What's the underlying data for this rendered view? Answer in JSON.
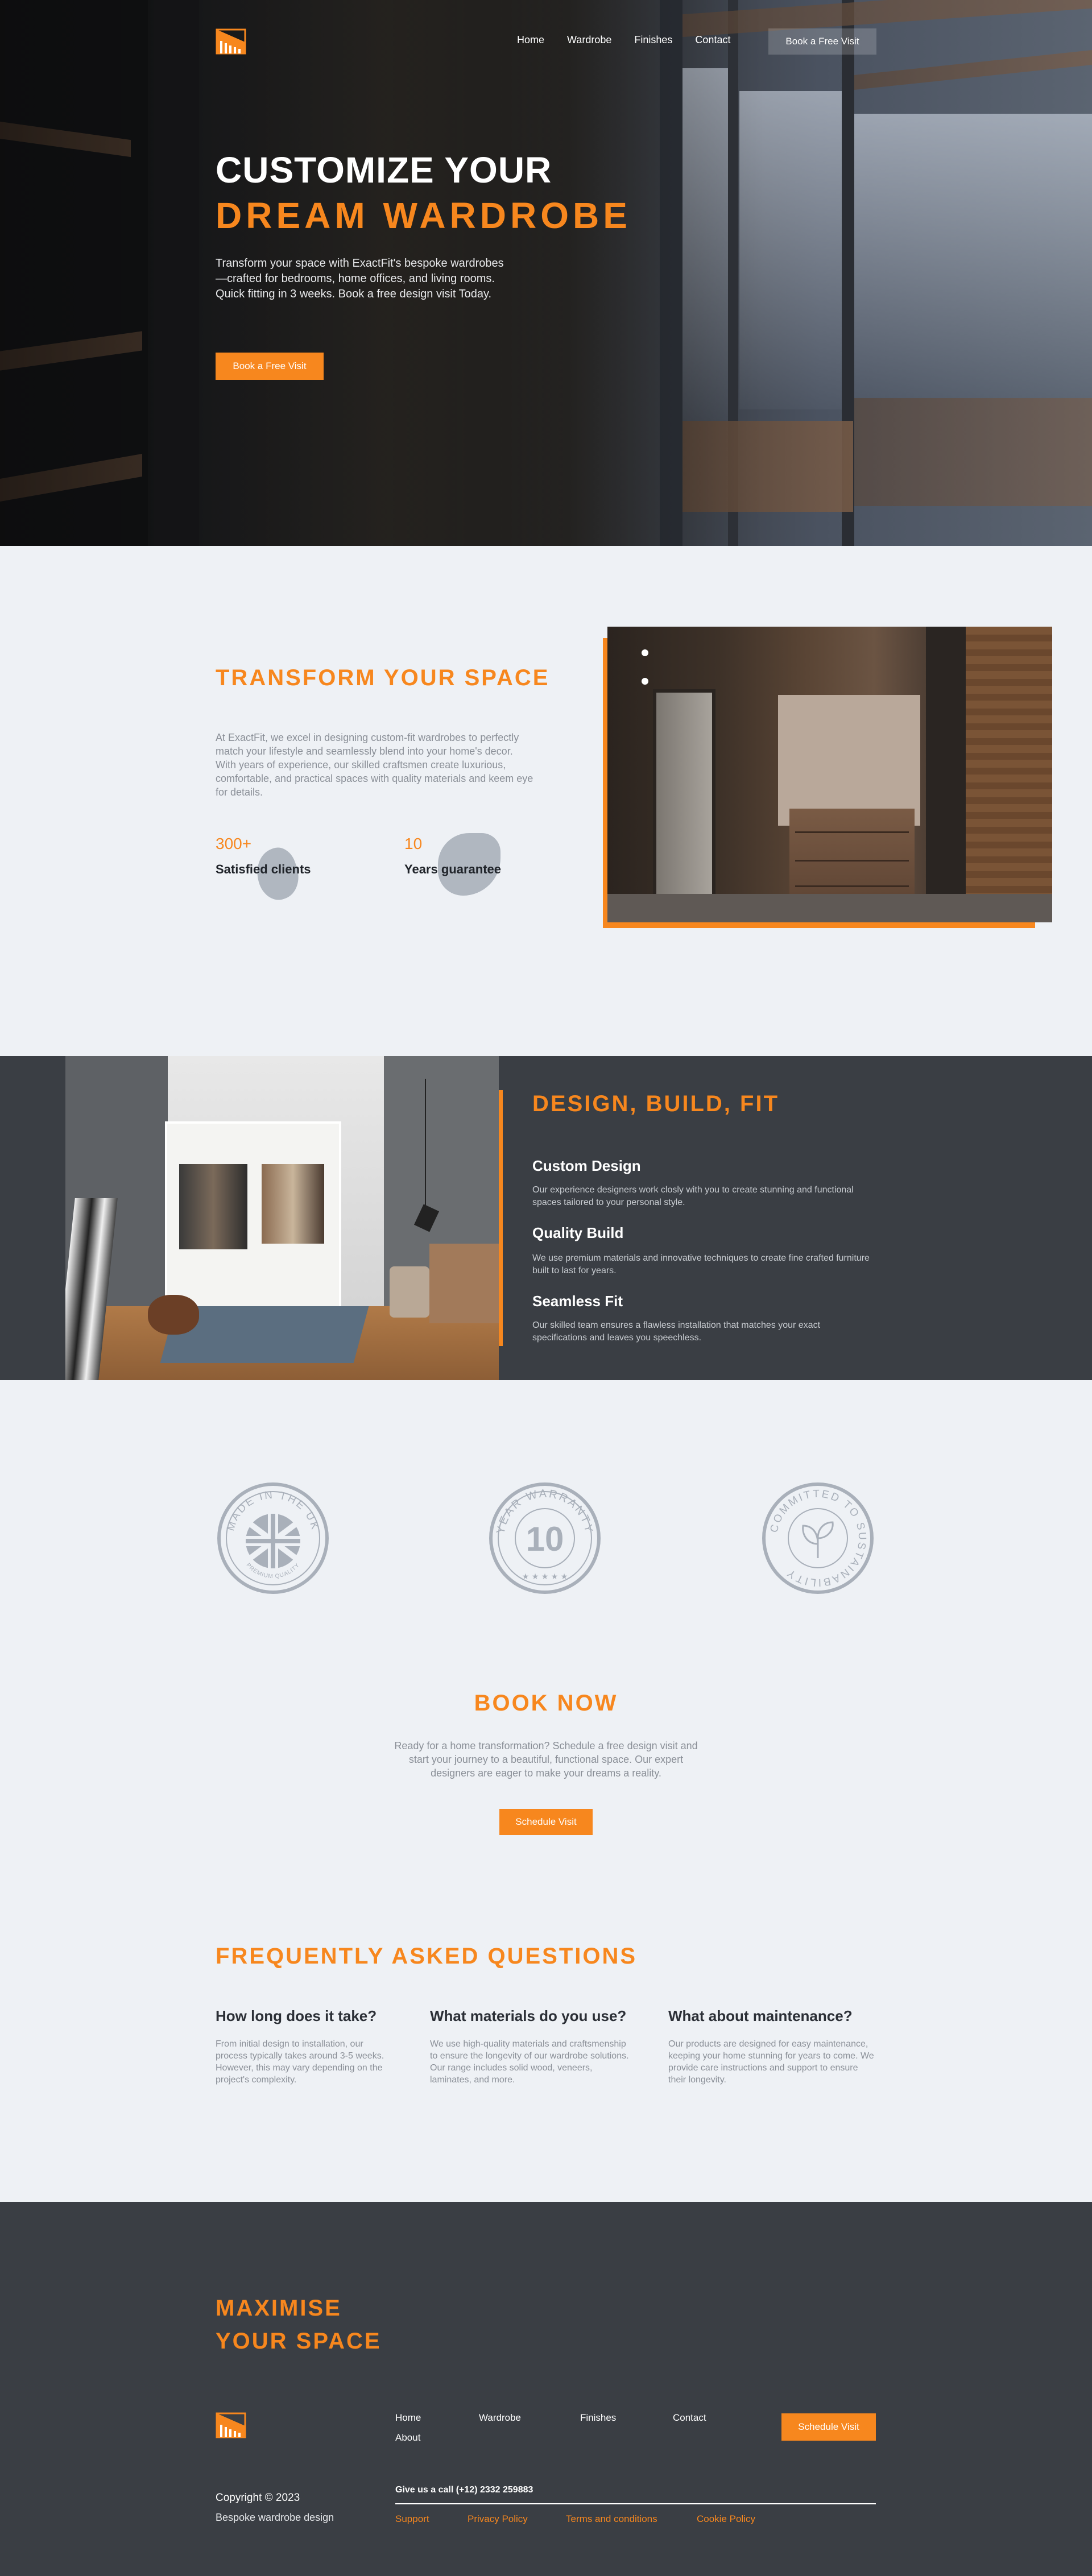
{
  "nav": {
    "links": [
      "Home",
      "Wardrobe",
      "Finishes",
      "Contact"
    ],
    "cta": "Book a Free Visit"
  },
  "hero": {
    "title_line1": "CUSTOMIZE YOUR",
    "title_line2": "DREAM WARDROBE",
    "text": "Transform your space with ExactFit's bespoke wardrobes—crafted for bedrooms, home offices, and living rooms. Quick fitting in 3 weeks. Book a free design visit Today.",
    "button": "Book a Free Visit"
  },
  "transform": {
    "title": "TRANSFORM YOUR SPACE",
    "text": "At ExactFit, we excel in designing custom-fit wardrobes to perfectly match your lifestyle and seamlessly blend into your home's decor. With years of experience, our skilled craftsmen create luxurious, comfortable, and practical spaces with quality materials and keem eye for details.",
    "stats": [
      {
        "value": "300+",
        "label": "Satisfied clients"
      },
      {
        "value": "10",
        "label": "Years guarantee"
      }
    ]
  },
  "dbf": {
    "title": "DESIGN, BUILD, FIT",
    "items": [
      {
        "heading": "Custom Design",
        "text": "Our experience designers work closly with you to create stunning and functional spaces tailored to your personal style."
      },
      {
        "heading": "Quality Build",
        "text": "We use premium materials and innovative techniques to create fine crafted furniture built to last for years."
      },
      {
        "heading": "Seamless Fit",
        "text": "Our skilled team ensures a flawless installation that matches your exact specifications and leaves you speechless."
      }
    ]
  },
  "badges": {
    "uk": {
      "top": "MADE IN THE UK",
      "bottom": "PREMIUM QUALITY"
    },
    "warranty": {
      "top": "YEAR WARRANTY",
      "number": "10"
    },
    "sustain": {
      "text": "COMMITTED TO SUSTAINABILITY"
    }
  },
  "book": {
    "title": "BOOK NOW",
    "text": "Ready for a home transformation? Schedule a free design visit and start your journey to a beautiful, functional space. Our expert designers are eager to make your dreams a reality.",
    "button": "Schedule Visit"
  },
  "faq": {
    "title": "FREQUENTLY ASKED QUESTIONS",
    "items": [
      {
        "q": "How long does it take?",
        "a": "From initial design to installation, our process typically takes around 3-5 weeks. However, this may vary depending on the project's complexity."
      },
      {
        "q": "What materials do you use?",
        "a": "We use high-quality materials and craftsmenship to ensure the longevity of our wardrobe solutions. Our range includes solid wood, veneers, laminates, and more."
      },
      {
        "q": "What about maintenance?",
        "a": "Our products are designed for easy maintenance, keeping your home stunning for years to come. We provide care instructions and support to ensure their longevity."
      }
    ]
  },
  "footer": {
    "title_line1": "MAXIMISE",
    "title_line2": "YOUR SPACE",
    "links": [
      "Home",
      "Wardrobe",
      "Finishes",
      "Contact",
      "About"
    ],
    "button": "Schedule Visit",
    "copyright": "Copyright © 2023",
    "subtitle": "Bespoke wardrobe design",
    "call": "Give us a call   (+12) 2332 259883",
    "legal": [
      "Support",
      "Privacy Policy",
      "Terms and conditions",
      "Cookie Policy"
    ]
  },
  "colors": {
    "accent": "#f7871e",
    "dark": "#3a3e44",
    "light": "#eef1f5"
  }
}
